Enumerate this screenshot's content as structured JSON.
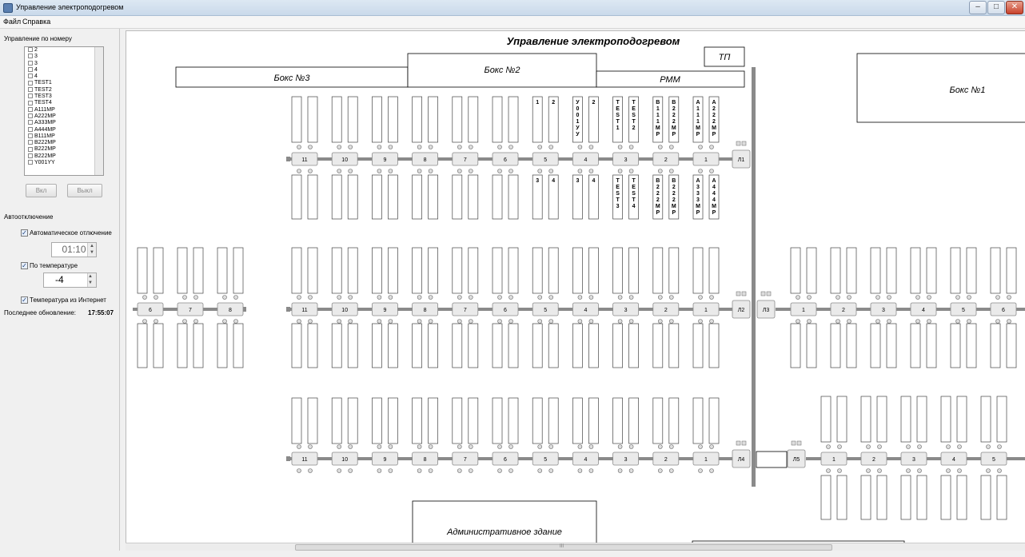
{
  "window": {
    "title": "Управление электроподогревом"
  },
  "menu": {
    "file": "Файл",
    "help": "Справка"
  },
  "left": {
    "by_number_title": "Управление по номеру",
    "list_items": [
      "2",
      "3",
      "3",
      "4",
      "4",
      "TEST1",
      "TEST2",
      "TEST3",
      "TEST4",
      "A111MP",
      "A222MP",
      "A333MP",
      "A444MP",
      "B111MP",
      "B222MP",
      "B222MP",
      "B222MP",
      "Y001YY"
    ],
    "btn_on": "Вкл",
    "btn_off": "Выкл",
    "auto_title": "Автоотключение",
    "auto_off_label": "Автоматическое отлючение",
    "auto_off_checked": true,
    "auto_off_time": "01:10",
    "by_temp_label": "По температуре",
    "by_temp_checked": true,
    "temp_value": "-4",
    "temp_internet_label": "Температура из Интернет",
    "temp_internet_checked": true,
    "last_update_label": "Последнее обновление:",
    "last_update_time": "17:55:07"
  },
  "plan": {
    "title": "Управление электроподогревом",
    "tp": "ТП",
    "box3": "Бокс №3",
    "box2": "Бокс №2",
    "box1": "Бокс №1",
    "pmm": "РММ",
    "admin": "Административное здание",
    "scroll_mark": "III",
    "lines": [
      "Л1",
      "Л2",
      "Л3",
      "Л4",
      "Л5"
    ],
    "row1_posts": [
      "11",
      "10",
      "9",
      "8",
      "7",
      "6",
      "5",
      "4",
      "3",
      "2",
      "1"
    ],
    "row2_left_posts": [
      "6",
      "7",
      "8"
    ],
    "row2_posts": [
      "11",
      "10",
      "9",
      "8",
      "7",
      "6",
      "5",
      "4",
      "3",
      "2",
      "1"
    ],
    "row2_right_posts": [
      "1",
      "2",
      "3",
      "4",
      "5",
      "6"
    ],
    "row3_posts": [
      "11",
      "10",
      "9",
      "8",
      "7",
      "6",
      "5",
      "4",
      "3",
      "2",
      "1"
    ],
    "row3_right_posts": [
      "1",
      "2",
      "3",
      "4",
      "5"
    ],
    "row1_top_labels": [
      {
        "post": "5",
        "a": "1",
        "b": "2"
      },
      {
        "post": "4",
        "a": "У001УУ",
        "b": "2"
      },
      {
        "post": "3",
        "a": "TEST1",
        "b": "TEST2"
      },
      {
        "post": "2",
        "a": "B111MP",
        "b": "B222MP"
      },
      {
        "post": "1",
        "a": "A111MP",
        "b": "A222MP"
      }
    ],
    "row1_bottom_labels": [
      {
        "post": "5",
        "a": "3",
        "b": "4"
      },
      {
        "post": "4",
        "a": "3",
        "b": "4"
      },
      {
        "post": "3",
        "a": "TEST3",
        "b": "TEST4"
      },
      {
        "post": "2",
        "a": "B222MP",
        "b": "B222MP"
      },
      {
        "post": "1",
        "a": "A333MP",
        "b": "A444MP"
      }
    ]
  }
}
